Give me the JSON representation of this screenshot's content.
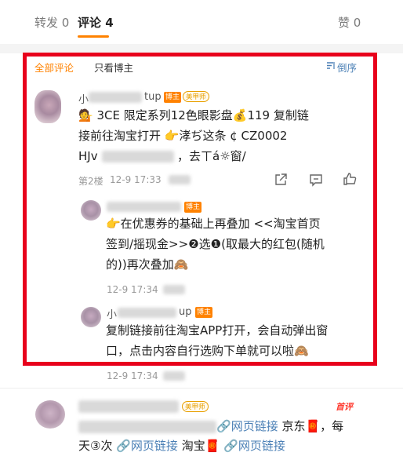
{
  "tabs": {
    "repost": "转发 0",
    "comment": "评论 4",
    "like": "赞 0"
  },
  "filters": {
    "all": "全部评论",
    "blogger_only": "只看博主",
    "sort": "倒序"
  },
  "badges": {
    "blogger": "博主",
    "star": "美甲师"
  },
  "main_comment": {
    "name_prefix": "小",
    "name_suffix": "tup",
    "line1": "💁 3CE 限定系列12色眼影盘💰119 复制链",
    "line2": "接前往淘宝打开 👉涍ぢ这条 ¢ CZ0002",
    "line3_prefix": "HJv",
    "line3_suffix": "，去ㄒá☼窗/",
    "floor": "第2楼",
    "time": "12-9 17:33"
  },
  "reply1": {
    "line1": "👉在优惠券的基础上再叠加 <<淘宝首页",
    "line2": "签到/摇现金>>❷选❶(取最大的红包(随机",
    "line3": "的))再次叠加🙈",
    "time": "12-9 17:34"
  },
  "reply2": {
    "name_prefix": "小",
    "name_suffix": "up",
    "line1": "复制链接前往淘宝APP打开，会自动弹出窗",
    "line2": "口，点击内容自行选购下单就可以啦🙈",
    "time": "12-9 17:34"
  },
  "next_comment": {
    "shoufa": "首评",
    "line1_link": "网页链接",
    "line1_suffix": "京东🧧，每",
    "line2_prefix": "天③次",
    "line2_link1": "网页链接",
    "line2_mid": "淘宝🧧",
    "line2_link2": "网页链接"
  },
  "colors": {
    "accent": "#ff8200",
    "highlight_border": "#e8001c",
    "link": "#4a7fb5"
  },
  "icons": [
    "sort-icon",
    "share-icon",
    "comment-icon",
    "like-icon"
  ]
}
